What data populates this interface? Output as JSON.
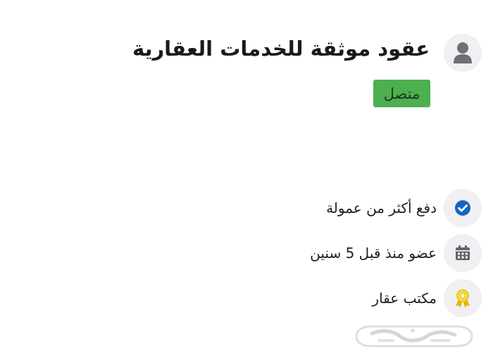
{
  "profile": {
    "avatar_icon": "user-icon",
    "name": "عقود موثقة للخدمات العقارية",
    "status": "متصل",
    "status_color": "#4caf50"
  },
  "features": [
    {
      "icon": "verified-check-icon",
      "label": "دفع أكثر من عمولة",
      "icon_color": "#1565c0"
    },
    {
      "icon": "calendar-icon",
      "label": "عضو منذ قبل 5 سنين",
      "icon_color": "#5f6368"
    },
    {
      "icon": "award-ribbon-icon",
      "label": "مكتب عقار",
      "icon_color": "#e0b800"
    }
  ],
  "watermark": {
    "brand": "حراج"
  }
}
